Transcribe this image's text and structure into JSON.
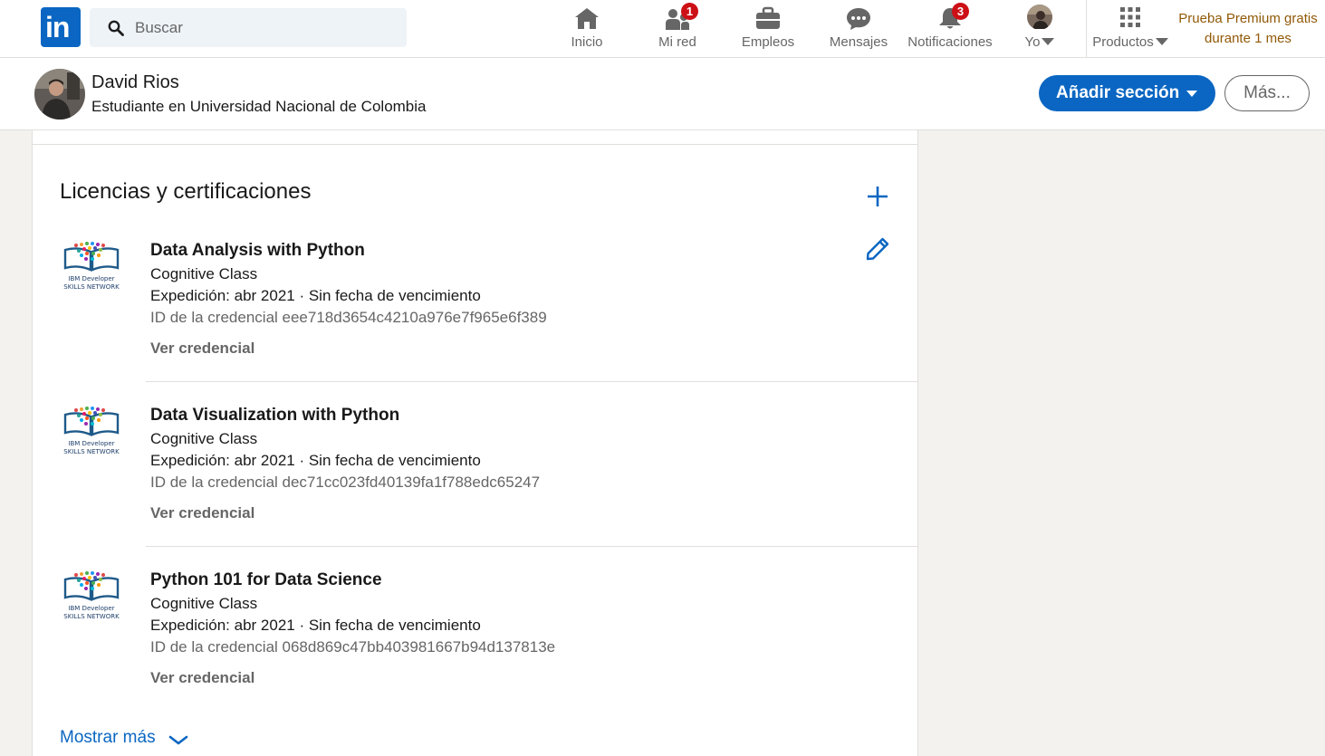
{
  "nav": {
    "logo_text": "in",
    "search_placeholder": "Buscar",
    "items": [
      {
        "label": "Inicio",
        "icon": "home-icon"
      },
      {
        "label": "Mi red",
        "icon": "network-icon",
        "badge": "1"
      },
      {
        "label": "Empleos",
        "icon": "briefcase-icon"
      },
      {
        "label": "Mensajes",
        "icon": "messaging-icon"
      },
      {
        "label": "Notificaciones",
        "icon": "bell-icon",
        "badge": "3"
      },
      {
        "label": "Yo",
        "icon": "avatar"
      },
      {
        "label": "Productos",
        "icon": "grid-icon"
      }
    ],
    "premium_line1": "Prueba Premium gratis",
    "premium_line2": "durante 1 mes"
  },
  "profile_bar": {
    "name": "David Rios",
    "headline": "Estudiante en Universidad Nacional de Colombia",
    "add_section_label": "Añadir sección",
    "more_label": "Más..."
  },
  "section": {
    "title": "Licencias y certificaciones",
    "certs": [
      {
        "title": "Data Analysis with Python",
        "org": "Cognitive Class",
        "date": "Expedición: abr 2021 · Sin fecha de vencimiento",
        "credential_id": "ID de la credencial eee718d3654c4210a976e7f965e6f389",
        "link": "Ver credencial",
        "logo_text_1": "IBM Developer",
        "logo_text_2": "SKILLS NETWORK"
      },
      {
        "title": "Data Visualization with Python",
        "org": "Cognitive Class",
        "date": "Expedición: abr 2021 · Sin fecha de vencimiento",
        "credential_id": "ID de la credencial dec71cc023fd40139fa1f788edc65247",
        "link": "Ver credencial",
        "logo_text_1": "IBM Developer",
        "logo_text_2": "SKILLS NETWORK"
      },
      {
        "title": "Python 101 for Data Science",
        "org": "Cognitive Class",
        "date": "Expedición: abr 2021 · Sin fecha de vencimiento",
        "credential_id": "ID de la credencial 068d869c47bb403981667b94d137813e",
        "link": "Ver credencial",
        "logo_text_1": "IBM Developer",
        "logo_text_2": "SKILLS NETWORK"
      }
    ],
    "show_more_label": "Mostrar más"
  },
  "colors": {
    "brand": "#0a66c2",
    "badge": "#cc1016",
    "premium": "#915907"
  }
}
